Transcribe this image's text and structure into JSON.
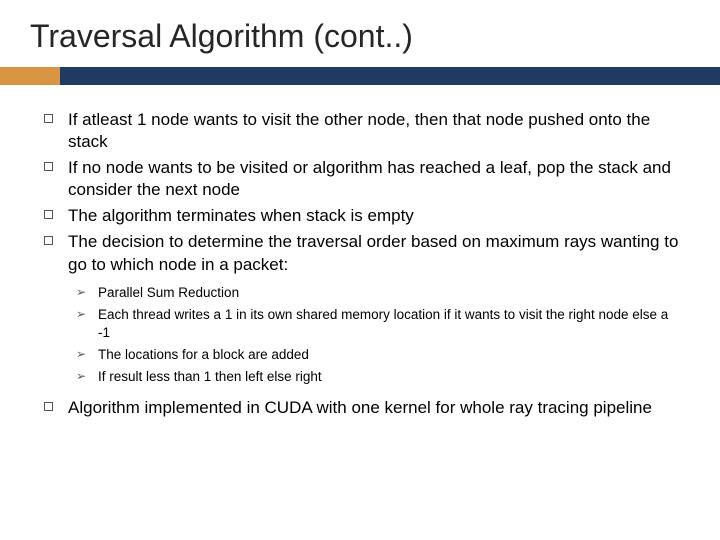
{
  "title": "Traversal Algorithm (cont..)",
  "bullets": {
    "b0": "If atleast 1 node wants to visit the other node, then that node pushed onto the stack",
    "b1": "If no node wants to be visited or algorithm has reached a leaf, pop the stack and consider the next node",
    "b2": "The algorithm terminates when stack is empty",
    "b3": "The decision to determine the traversal order based on maximum rays wanting to go to which node in a packet:",
    "b4": "Algorithm implemented in CUDA with one kernel for whole ray tracing pipeline"
  },
  "sub": {
    "s0": "Parallel Sum Reduction",
    "s1": "Each thread writes a 1 in its own shared memory location if it wants to visit the right node else a -1",
    "s2": "The locations for a block are added",
    "s3": "If result less than 1 then left else right"
  }
}
